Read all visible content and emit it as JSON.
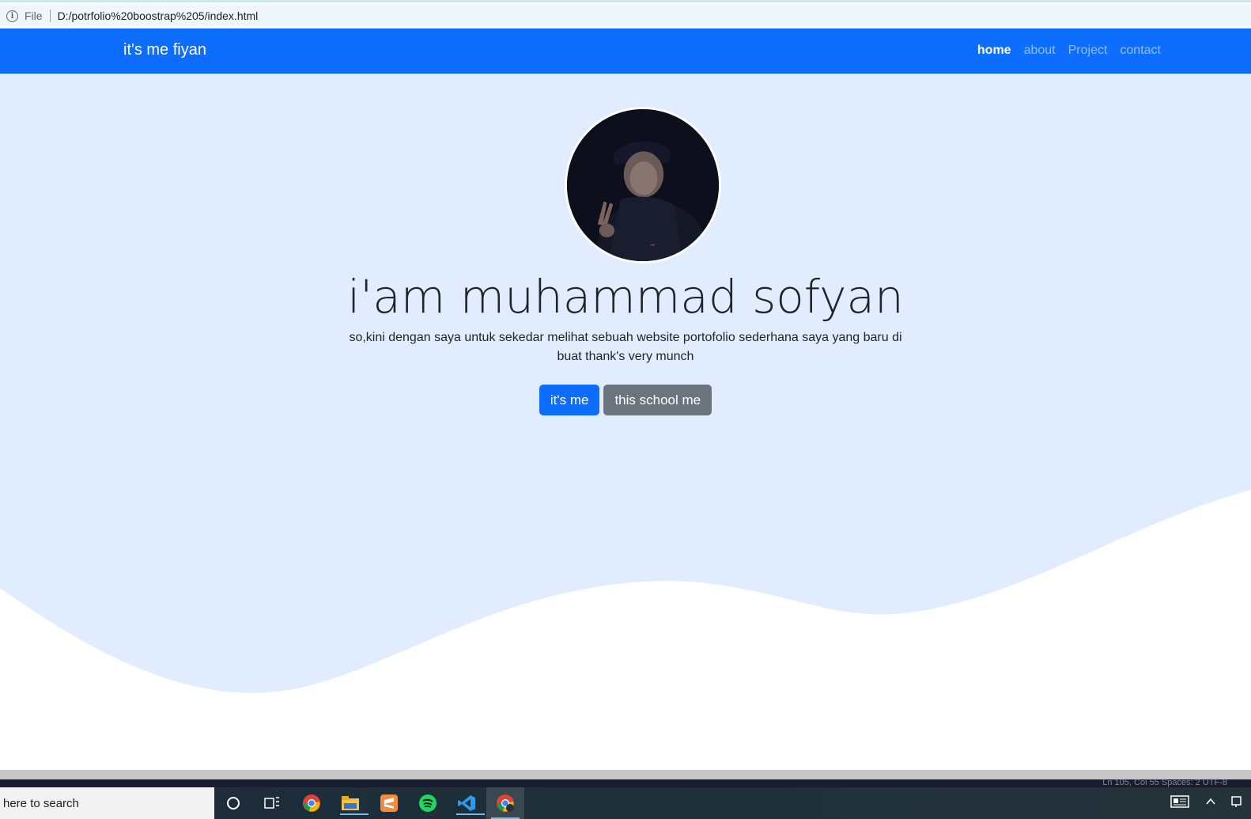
{
  "browser": {
    "file_label": "File",
    "url": "D:/potrfolio%20boostrap%205/index.html"
  },
  "navbar": {
    "brand": "it's me fiyan",
    "links": [
      {
        "label": "home",
        "active": true
      },
      {
        "label": "about",
        "active": false
      },
      {
        "label": "Project",
        "active": false
      },
      {
        "label": "contact",
        "active": false
      }
    ]
  },
  "hero": {
    "title": "i'am muhammad sofyan",
    "text": "so,kini dengan saya untuk sekedar melihat sebuah website portofolio sederhana saya yang baru di buat thank's very munch",
    "primary_button": "it's me",
    "secondary_button": "this school me",
    "background_color": "#e1ecfe",
    "accent_color": "#0d6efd"
  },
  "editor_status": {
    "text": "Ln 105, Col 55   Spaces: 2   UTF-8"
  },
  "taskbar": {
    "search_placeholder": "here to search",
    "apps": [
      "cortana-icon",
      "task-view-icon",
      "chrome-icon",
      "file-explorer-icon",
      "sublime-icon",
      "spotify-icon",
      "vscode-icon",
      "chrome-profile-icon"
    ]
  }
}
